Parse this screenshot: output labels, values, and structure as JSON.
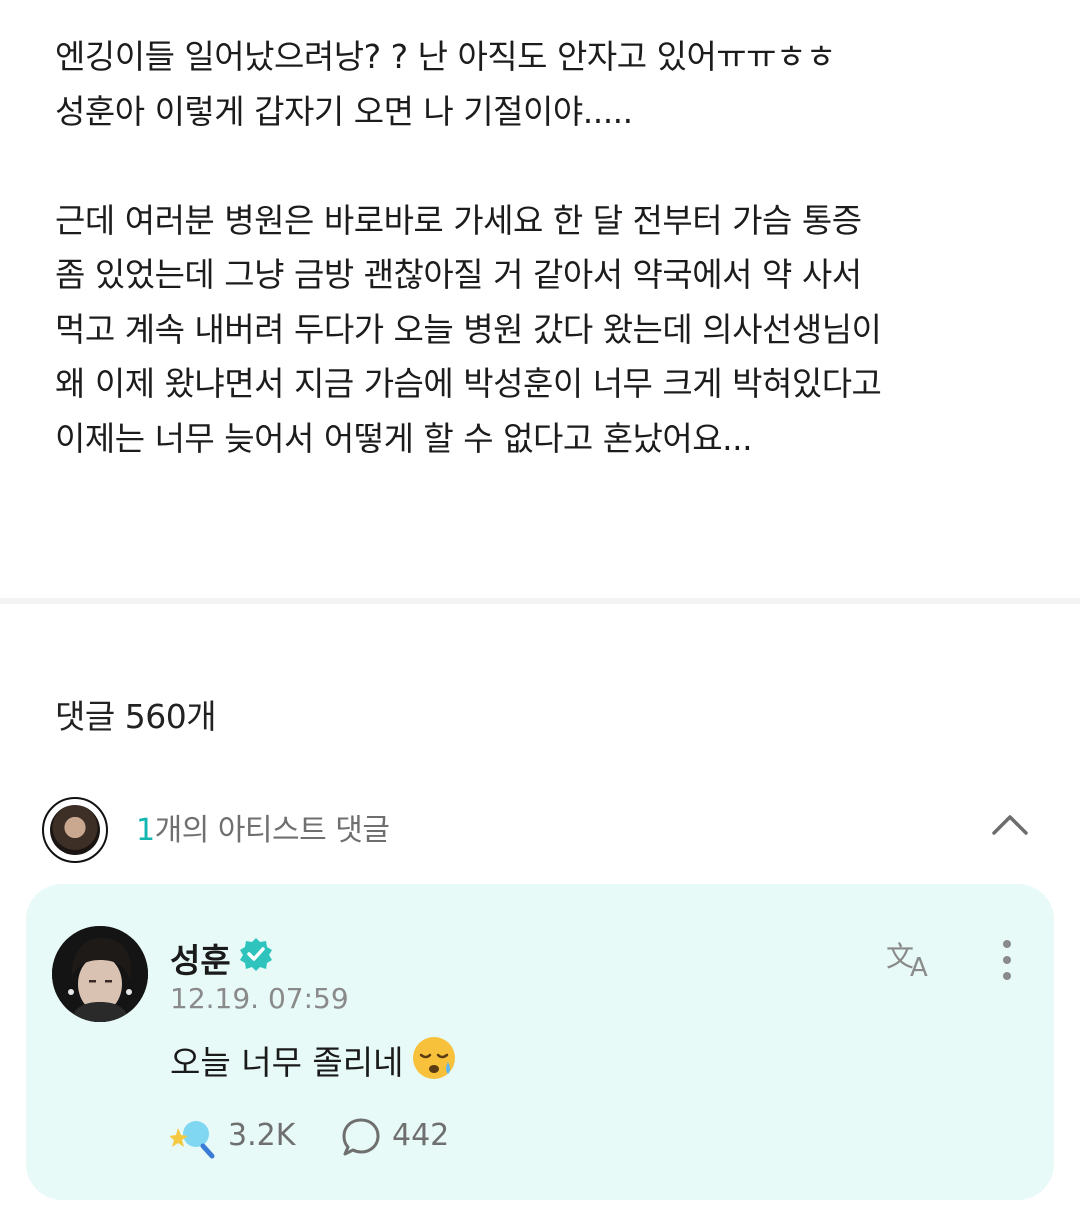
{
  "post": {
    "lines": [
      "엔깅이들 일어났으려낭? ? 난 아직도 안자고 있어ㅠㅠㅎㅎ",
      "성훈아 이렇게 갑자기 오면 나 기절이야.....",
      "근데 여러분 병원은 바로바로 가세요 한 달 전부터 가슴 통증",
      "좀 있었는데 그냥 금방 괜찮아질 거 같아서 약국에서 약 사서",
      "먹고 계속 내버려 두다가 오늘 병원 갔다 왔는데 의사선생님이",
      "왜 이제 왔냐면서 지금 가슴에 박성훈이 너무 크게 박혀있다고",
      "이제는 너무 늦어서 어떻게 할 수 없다고 혼났어요..."
    ]
  },
  "comments": {
    "count_label": "댓글 560개"
  },
  "artist_bar": {
    "count": "1",
    "label": "개의 아티스트 댓글"
  },
  "artist_comment": {
    "author": "성훈",
    "timestamp": "12.19. 07:59",
    "text": "오늘 너무 졸리네",
    "likes": "3.2K",
    "replies": "442"
  },
  "colors": {
    "accent": "#11b6b0",
    "card_bg": "#e7faf7",
    "verified": "#2ec4bd"
  },
  "icons": [
    "chevron-up-icon",
    "verified-icon",
    "translate-icon",
    "more-vertical-icon",
    "sleepy-face-emoji",
    "like-sparkle-icon",
    "reply-bubble-icon"
  ]
}
